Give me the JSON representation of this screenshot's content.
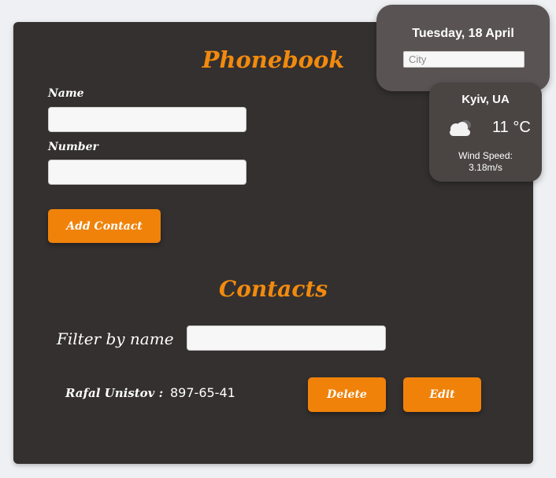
{
  "phonebook": {
    "title": "Phonebook",
    "name_label": "Name",
    "name_value": "",
    "number_label": "Number",
    "number_value": "",
    "add_button": "Add Contact"
  },
  "contacts": {
    "title": "Contacts",
    "filter_label": "Filter by name",
    "filter_value": "",
    "items": [
      {
        "name": "Rafal Unistov :",
        "number": "897-65-41",
        "delete_label": "Delete",
        "edit_label": "Edit"
      }
    ]
  },
  "weather": {
    "date": "Tuesday, 18 April",
    "city_placeholder": "City",
    "city_value": "",
    "location": "Kyiv, UA",
    "icon": "cloudy-icon",
    "temperature": "11 °C",
    "wind_label": "Wind Speed:",
    "wind_value": "3.18m/s"
  },
  "colors": {
    "accent": "#f0820a",
    "card_background": "#33302f",
    "page_background": "#eef0f3"
  }
}
